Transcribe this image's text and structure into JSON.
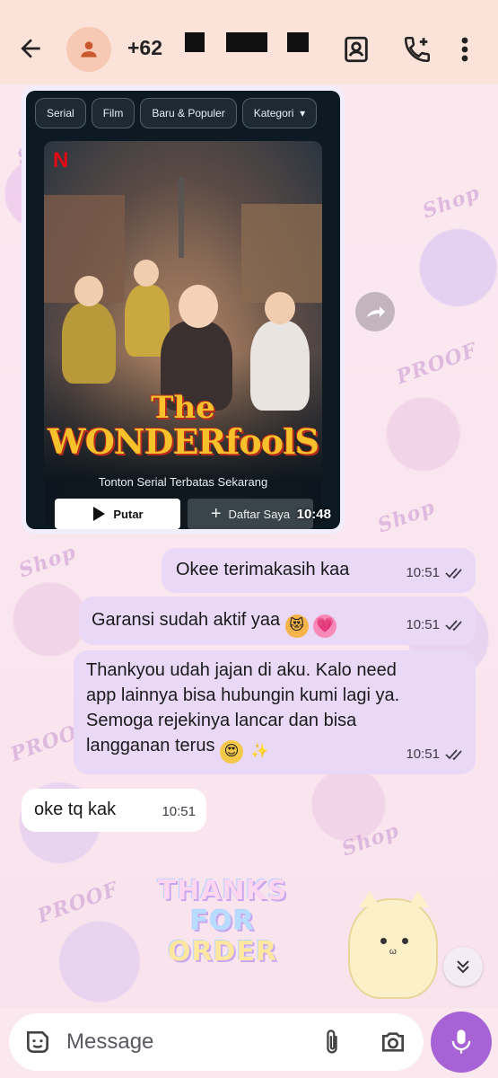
{
  "header": {
    "contact_name": "+62",
    "avatar_color": "#f7c8b4",
    "icons": [
      "back-arrow-icon",
      "person-icon",
      "contacts-icon",
      "add-call-icon",
      "more-vert-icon"
    ]
  },
  "media_message": {
    "chips": [
      "Serial",
      "Film",
      "Baru & Populer",
      "Kategori"
    ],
    "poster": {
      "brand": "N",
      "title_the": "The",
      "title_main": "WONDERfoolS",
      "tagline": "Tonton Serial Terbatas Sekarang",
      "play_label": "Putar",
      "mylist_label": "Daftar Saya"
    },
    "time": "10:48"
  },
  "messages": [
    {
      "direction": "out",
      "text": "Okee terimakasih kaa",
      "time": "10:51"
    },
    {
      "direction": "out",
      "text": "Garansi sudah aktif yaa",
      "emojis": [
        "😻",
        "💗"
      ],
      "time": "10:51"
    },
    {
      "direction": "out",
      "text": "Thankyou udah jajan di aku. Kalo need app lainnya bisa hubungin kumi lagi ya. Semoga rejekinya lancar dan bisa langganan terus",
      "emojis": [
        "😍",
        "✨"
      ],
      "time": "10:51"
    },
    {
      "direction": "in",
      "text": "oke tq kak",
      "time": "10:51"
    }
  ],
  "sticker": {
    "lines": [
      "THANKS",
      "FOR",
      "ORDER"
    ]
  },
  "composer": {
    "placeholder": "Message"
  },
  "colors": {
    "header_bg": "#fbe3d9",
    "outgoing_bubble": "#e9d9f7",
    "incoming_bubble": "#ffffff",
    "mic_button": "#a763d6"
  }
}
